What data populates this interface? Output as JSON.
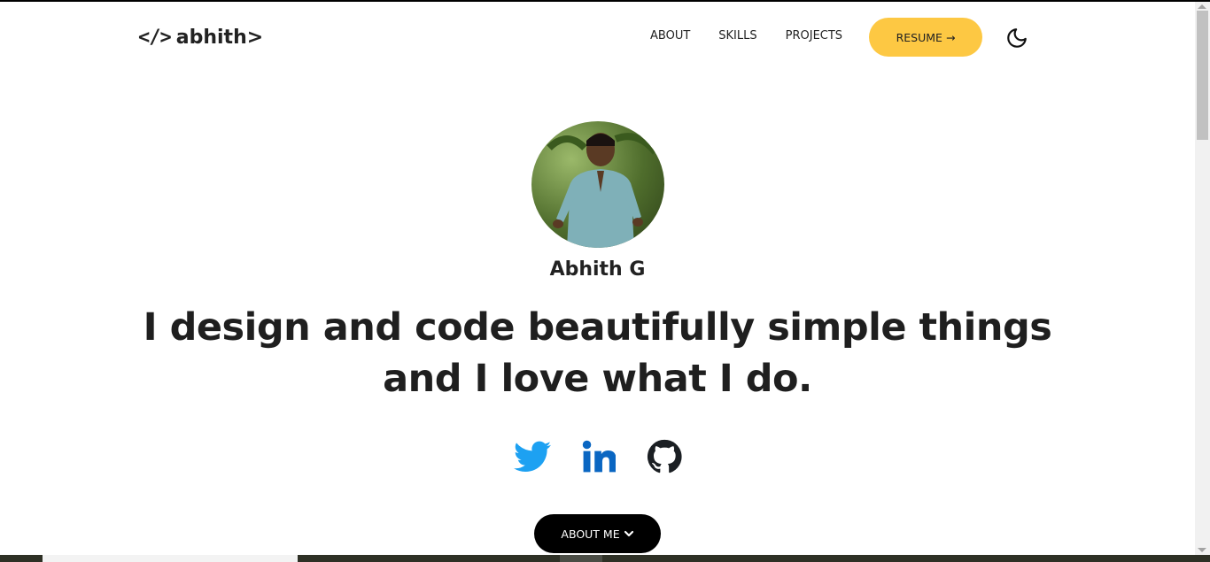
{
  "header": {
    "logo_icon": "</>",
    "logo_text": "abhith>",
    "nav": [
      {
        "label": "ABOUT"
      },
      {
        "label": "SKILLS"
      },
      {
        "label": "PROJECTS"
      }
    ],
    "resume_label": "RESUME",
    "resume_arrow": "→",
    "theme_icon": "moon-icon"
  },
  "hero": {
    "name": "Abhith G",
    "headline_line1": "I design and code beautifully simple things",
    "headline_line2": "and I love what I do.",
    "socials": [
      {
        "name": "twitter-icon",
        "color": "#1da1f2"
      },
      {
        "name": "linkedin-icon",
        "color": "#0a66c2"
      },
      {
        "name": "github-icon",
        "color": "#1b1f23"
      }
    ],
    "about_label": "ABOUT ME",
    "about_icon": "chevron-down-icon"
  },
  "colors": {
    "accent": "#fdc843",
    "text": "#222222",
    "button_dark": "#000000"
  }
}
